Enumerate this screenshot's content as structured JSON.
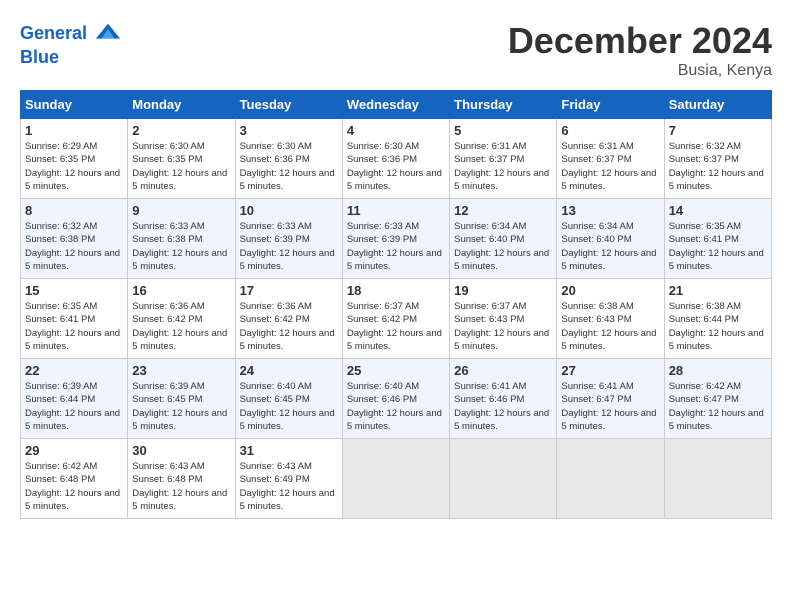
{
  "header": {
    "logo_line1": "General",
    "logo_line2": "Blue",
    "title": "December 2024",
    "subtitle": "Busia, Kenya"
  },
  "calendar": {
    "headers": [
      "Sunday",
      "Monday",
      "Tuesday",
      "Wednesday",
      "Thursday",
      "Friday",
      "Saturday"
    ],
    "weeks": [
      [
        {
          "day": "1",
          "sunrise": "6:29 AM",
          "sunset": "6:35 PM",
          "daylight": "12 hours and 5 minutes."
        },
        {
          "day": "2",
          "sunrise": "6:30 AM",
          "sunset": "6:35 PM",
          "daylight": "12 hours and 5 minutes."
        },
        {
          "day": "3",
          "sunrise": "6:30 AM",
          "sunset": "6:36 PM",
          "daylight": "12 hours and 5 minutes."
        },
        {
          "day": "4",
          "sunrise": "6:30 AM",
          "sunset": "6:36 PM",
          "daylight": "12 hours and 5 minutes."
        },
        {
          "day": "5",
          "sunrise": "6:31 AM",
          "sunset": "6:37 PM",
          "daylight": "12 hours and 5 minutes."
        },
        {
          "day": "6",
          "sunrise": "6:31 AM",
          "sunset": "6:37 PM",
          "daylight": "12 hours and 5 minutes."
        },
        {
          "day": "7",
          "sunrise": "6:32 AM",
          "sunset": "6:37 PM",
          "daylight": "12 hours and 5 minutes."
        }
      ],
      [
        {
          "day": "8",
          "sunrise": "6:32 AM",
          "sunset": "6:38 PM",
          "daylight": "12 hours and 5 minutes."
        },
        {
          "day": "9",
          "sunrise": "6:33 AM",
          "sunset": "6:38 PM",
          "daylight": "12 hours and 5 minutes."
        },
        {
          "day": "10",
          "sunrise": "6:33 AM",
          "sunset": "6:39 PM",
          "daylight": "12 hours and 5 minutes."
        },
        {
          "day": "11",
          "sunrise": "6:33 AM",
          "sunset": "6:39 PM",
          "daylight": "12 hours and 5 minutes."
        },
        {
          "day": "12",
          "sunrise": "6:34 AM",
          "sunset": "6:40 PM",
          "daylight": "12 hours and 5 minutes."
        },
        {
          "day": "13",
          "sunrise": "6:34 AM",
          "sunset": "6:40 PM",
          "daylight": "12 hours and 5 minutes."
        },
        {
          "day": "14",
          "sunrise": "6:35 AM",
          "sunset": "6:41 PM",
          "daylight": "12 hours and 5 minutes."
        }
      ],
      [
        {
          "day": "15",
          "sunrise": "6:35 AM",
          "sunset": "6:41 PM",
          "daylight": "12 hours and 5 minutes."
        },
        {
          "day": "16",
          "sunrise": "6:36 AM",
          "sunset": "6:42 PM",
          "daylight": "12 hours and 5 minutes."
        },
        {
          "day": "17",
          "sunrise": "6:36 AM",
          "sunset": "6:42 PM",
          "daylight": "12 hours and 5 minutes."
        },
        {
          "day": "18",
          "sunrise": "6:37 AM",
          "sunset": "6:42 PM",
          "daylight": "12 hours and 5 minutes."
        },
        {
          "day": "19",
          "sunrise": "6:37 AM",
          "sunset": "6:43 PM",
          "daylight": "12 hours and 5 minutes."
        },
        {
          "day": "20",
          "sunrise": "6:38 AM",
          "sunset": "6:43 PM",
          "daylight": "12 hours and 5 minutes."
        },
        {
          "day": "21",
          "sunrise": "6:38 AM",
          "sunset": "6:44 PM",
          "daylight": "12 hours and 5 minutes."
        }
      ],
      [
        {
          "day": "22",
          "sunrise": "6:39 AM",
          "sunset": "6:44 PM",
          "daylight": "12 hours and 5 minutes."
        },
        {
          "day": "23",
          "sunrise": "6:39 AM",
          "sunset": "6:45 PM",
          "daylight": "12 hours and 5 minutes."
        },
        {
          "day": "24",
          "sunrise": "6:40 AM",
          "sunset": "6:45 PM",
          "daylight": "12 hours and 5 minutes."
        },
        {
          "day": "25",
          "sunrise": "6:40 AM",
          "sunset": "6:46 PM",
          "daylight": "12 hours and 5 minutes."
        },
        {
          "day": "26",
          "sunrise": "6:41 AM",
          "sunset": "6:46 PM",
          "daylight": "12 hours and 5 minutes."
        },
        {
          "day": "27",
          "sunrise": "6:41 AM",
          "sunset": "6:47 PM",
          "daylight": "12 hours and 5 minutes."
        },
        {
          "day": "28",
          "sunrise": "6:42 AM",
          "sunset": "6:47 PM",
          "daylight": "12 hours and 5 minutes."
        }
      ],
      [
        {
          "day": "29",
          "sunrise": "6:42 AM",
          "sunset": "6:48 PM",
          "daylight": "12 hours and 5 minutes."
        },
        {
          "day": "30",
          "sunrise": "6:43 AM",
          "sunset": "6:48 PM",
          "daylight": "12 hours and 5 minutes."
        },
        {
          "day": "31",
          "sunrise": "6:43 AM",
          "sunset": "6:49 PM",
          "daylight": "12 hours and 5 minutes."
        },
        null,
        null,
        null,
        null
      ]
    ]
  }
}
